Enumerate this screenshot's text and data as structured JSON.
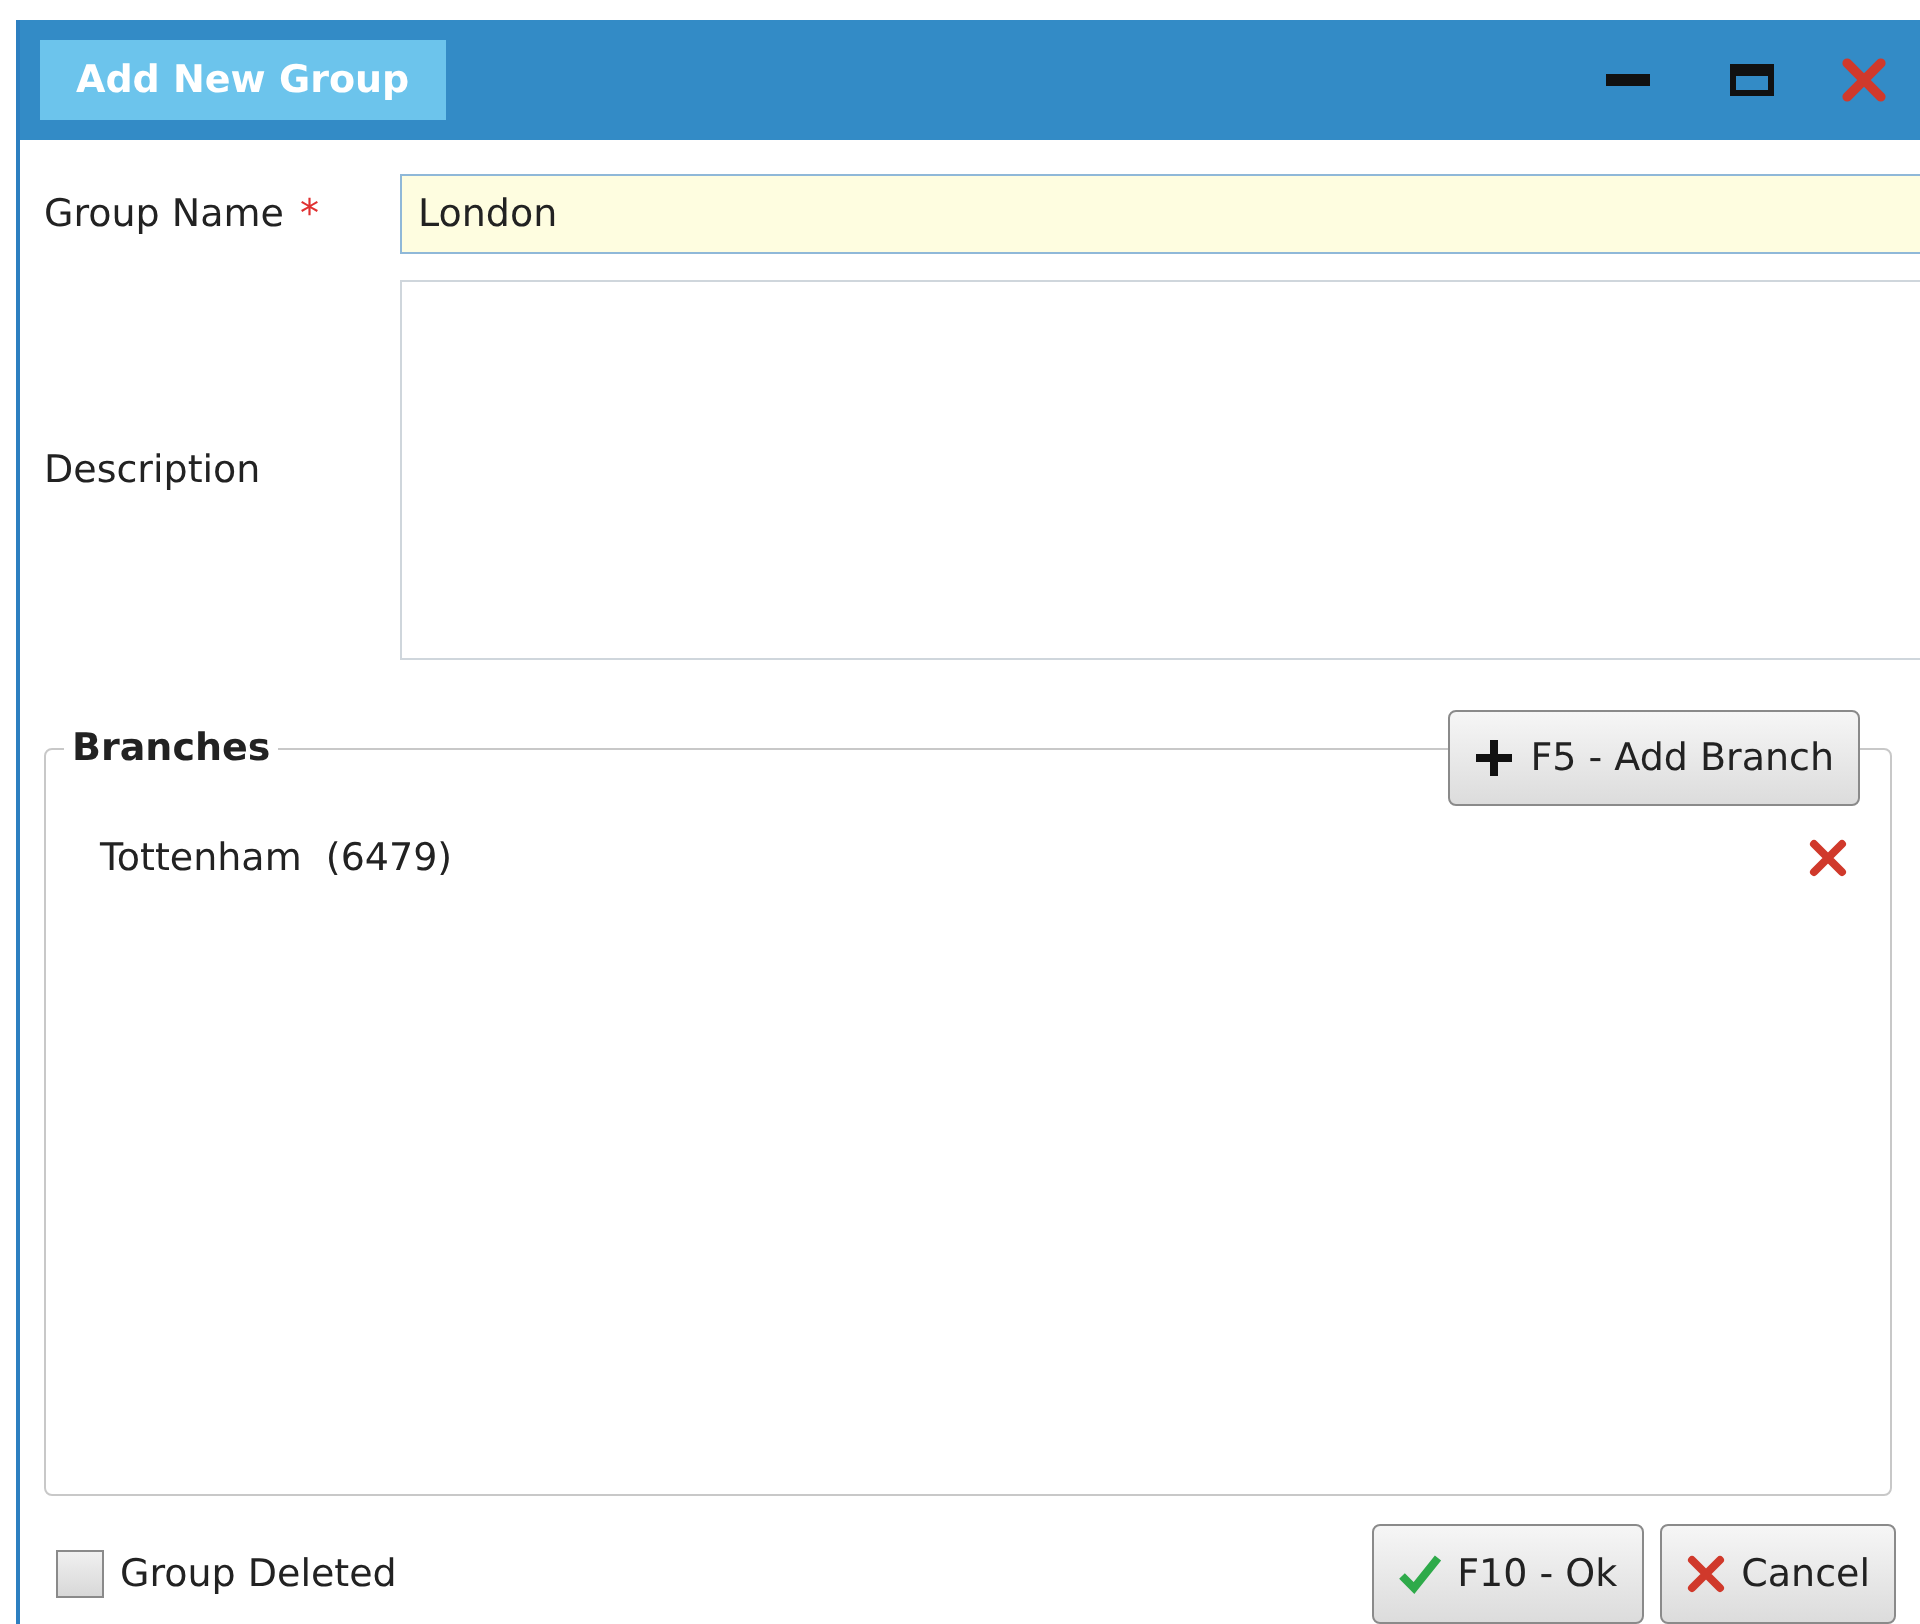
{
  "window": {
    "title": "Add New Group"
  },
  "group_name": {
    "label": "Group Name",
    "required_mark": "*",
    "value": "London"
  },
  "description": {
    "label": "Description"
  },
  "branches": {
    "title": "Branches",
    "add_button": "F5 - Add Branch",
    "items": [
      {
        "label": "Tottenham  (6479)"
      }
    ]
  },
  "group_deleted": {
    "label": "Group Deleted",
    "checked": false
  },
  "buttons": [
    {
      "kind": "ok",
      "label": "F10 - Ok"
    },
    {
      "kind": "cancel",
      "label": "Cancel"
    }
  ]
}
